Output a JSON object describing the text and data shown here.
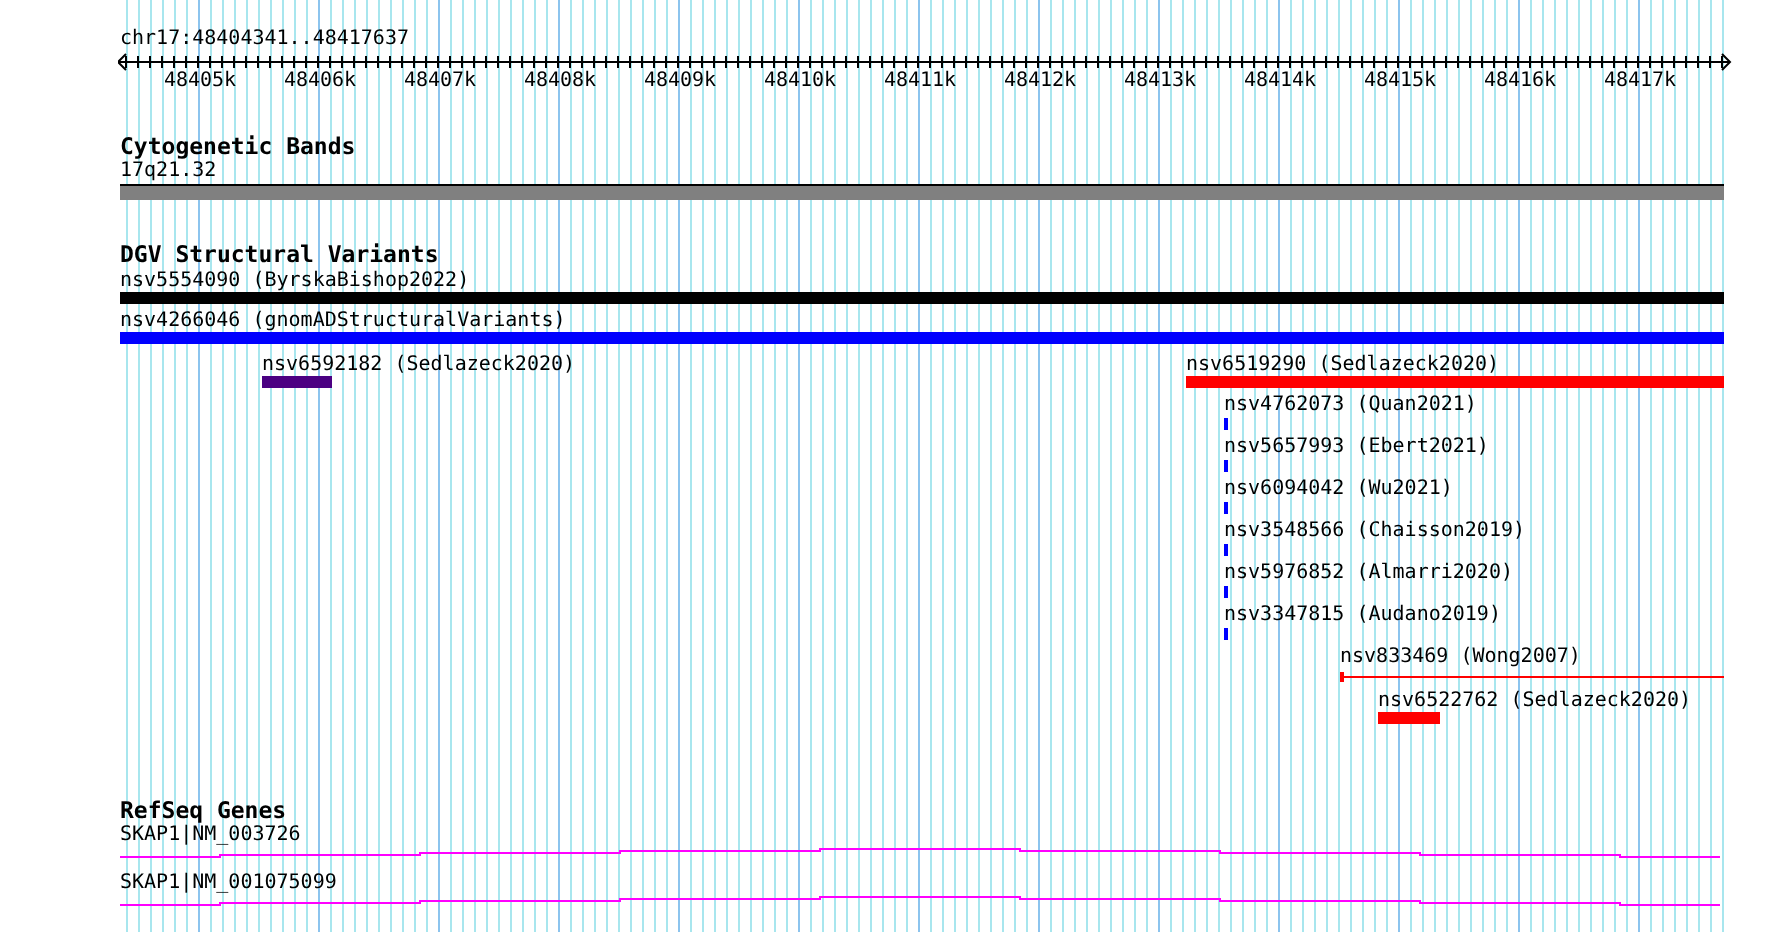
{
  "ruler": {
    "location": "chr17:48404341..48417637",
    "ticks": [
      "48405k",
      "48406k",
      "48407k",
      "48408k",
      "48409k",
      "48410k",
      "48411k",
      "48412k",
      "48413k",
      "48414k",
      "48415k",
      "48416k",
      "48417k"
    ]
  },
  "tracks": [
    {
      "title": "Cytogenetic Bands",
      "kind": "bands",
      "features": [
        {
          "label": "17q21.32"
        }
      ]
    },
    {
      "title": "DGV Structural Variants",
      "kind": "variants",
      "features": [
        {
          "label": "nsv5554090 (ByrskaBishop2022)",
          "kind": "bar",
          "color": "#000000"
        },
        {
          "label": "nsv4266046 (gnomADStructuralVariants)",
          "kind": "bar",
          "color": "#0000ff"
        },
        {
          "label": "nsv6592182 (Sedlazeck2020)",
          "kind": "bar",
          "color": "#4b0082"
        },
        {
          "label": "nsv6519290 (Sedlazeck2020)",
          "kind": "bar",
          "color": "#ff0000"
        },
        {
          "label": "nsv4762073 (Quan2021)",
          "kind": "mark",
          "color": "#0000ff"
        },
        {
          "label": "nsv5657993 (Ebert2021)",
          "kind": "mark",
          "color": "#0000ff"
        },
        {
          "label": "nsv6094042 (Wu2021)",
          "kind": "mark",
          "color": "#0000ff"
        },
        {
          "label": "nsv3548566 (Chaisson2019)",
          "kind": "mark",
          "color": "#0000ff"
        },
        {
          "label": "nsv5976852 (Almarri2020)",
          "kind": "mark",
          "color": "#0000ff"
        },
        {
          "label": "nsv3347815 (Audano2019)",
          "kind": "mark",
          "color": "#0000ff"
        },
        {
          "label": "nsv833469 (Wong2007)",
          "kind": "line",
          "color": "#ff0000"
        },
        {
          "label": "nsv6522762 (Sedlazeck2020)",
          "kind": "bar",
          "color": "#ff0000"
        }
      ]
    },
    {
      "title": "RefSeq Genes",
      "kind": "genes",
      "features": [
        {
          "label": "SKAP1|NM_003726"
        },
        {
          "label": "SKAP1|NM_001075099"
        }
      ]
    }
  ]
}
